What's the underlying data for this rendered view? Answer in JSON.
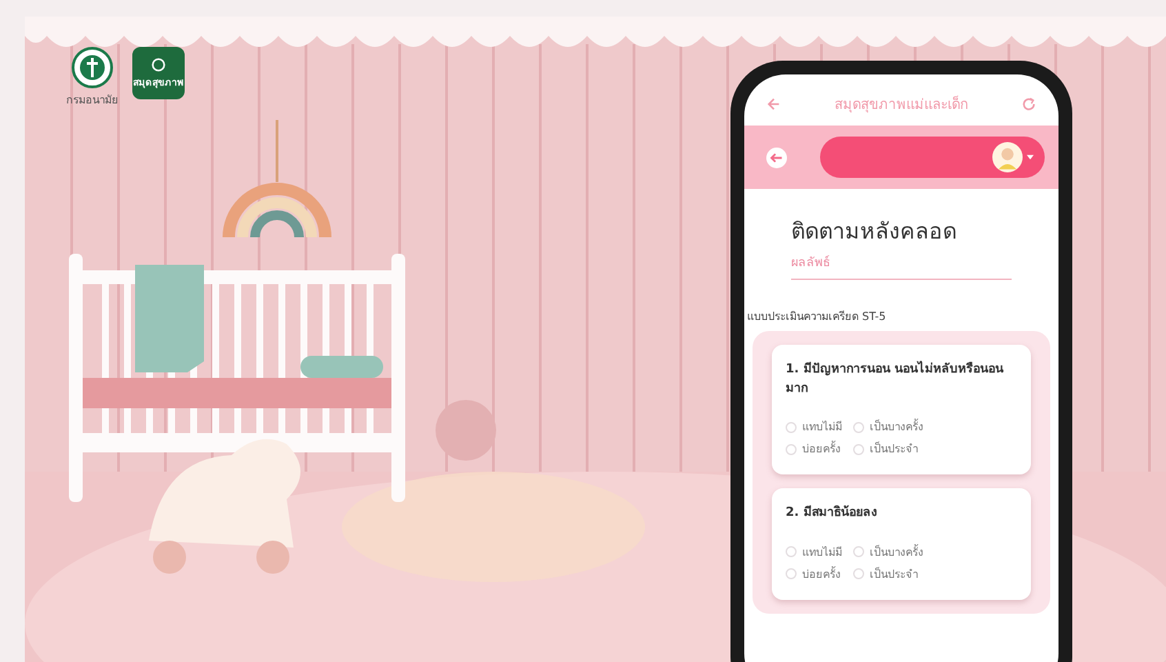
{
  "logos": [
    {
      "kind": "ministry",
      "label": "กรมอนามัย"
    },
    {
      "kind": "app",
      "label": "สมุดสุขภาพ"
    }
  ],
  "phone": {
    "app_title": "สมุดสุขภาพแม่และเด็ก",
    "page_title": "ติดตามหลังคลอด",
    "field": {
      "placeholder": "ผลลัพธ์"
    },
    "section_title": "แบบประเมินความเครียด ST-5",
    "questions": [
      {
        "text": "1. มีปัญหาการนอน นอนไม่หลับหรือนอนมาก",
        "options": [
          {
            "label": "แทบไม่มี",
            "selected": false
          },
          {
            "label": "เป็นบางครั้ง",
            "selected": false
          },
          {
            "label": "บ่อยครั้ง",
            "selected": false
          },
          {
            "label": "เป็นประจำ",
            "selected": false
          }
        ]
      },
      {
        "text": "2. มีสมาธิน้อยลง",
        "options": [
          {
            "label": "แทบไม่มี",
            "selected": false
          },
          {
            "label": "เป็นบางครั้ง",
            "selected": false
          },
          {
            "label": "บ่อยครั้ง",
            "selected": false
          },
          {
            "label": "เป็นประจำ",
            "selected": false
          }
        ]
      }
    ]
  }
}
